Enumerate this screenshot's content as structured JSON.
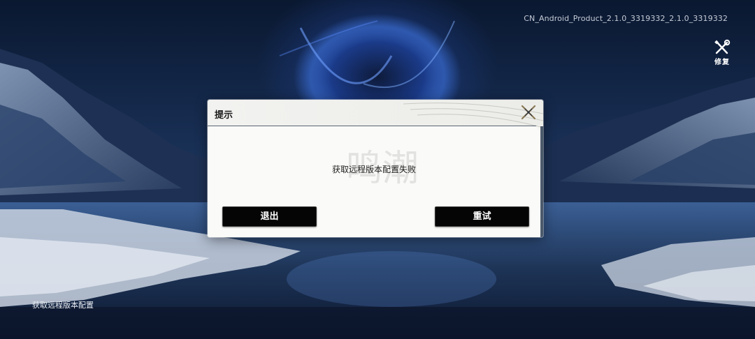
{
  "build_info": "CN_Android_Product_2.1.0_3319332_2.1.0_3319332",
  "repair": {
    "label": "修复",
    "icon": "wrench-screwdriver-icon"
  },
  "status_text": "获取远程版本配置",
  "dialog": {
    "title": "提示",
    "message": "获取远程版本配置失败",
    "watermark_text": "鸣潮",
    "close_icon": "close-x-icon",
    "buttons": {
      "exit": "退出",
      "retry": "重试"
    }
  },
  "colors": {
    "accent_gold": "#8a7a55",
    "button_bg": "#050505",
    "dialog_bg": "#f6f6f4"
  }
}
